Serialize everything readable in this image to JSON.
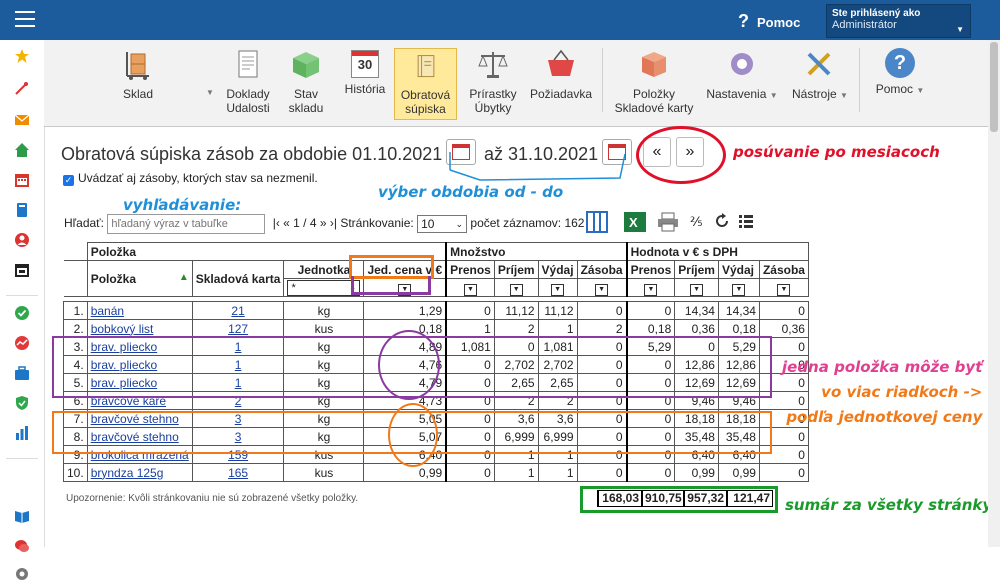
{
  "header": {
    "help_label": "Pomoc",
    "user_line1": "Ste prihlásený ako",
    "user_line2": "Administrátor"
  },
  "toolbar": {
    "sklad": "Sklad",
    "doklady1": "Doklady",
    "doklady2": "Udalosti",
    "stav1": "Stav",
    "stav2": "skladu",
    "historia": "História",
    "historia_day": "30",
    "obratova1": "Obratová",
    "obratova2": "súpiska",
    "prirastky1": "Prírastky",
    "prirastky2": "Úbytky",
    "poziadavka": "Požiadavka",
    "polozky1": "Položky",
    "polozky2": "Skladové karty",
    "nastavenia": "Nastavenia",
    "nastroje": "Nástroje",
    "pomoc": "Pomoc"
  },
  "page": {
    "title": "Obratová súpiska zásob za obdobie 01.10.2021",
    "to": "až 31.10.2021",
    "checkbox": "Uvádzať aj zásoby, ktorých stav sa nezmenil.",
    "prev": "«",
    "next": "»"
  },
  "search": {
    "label": "Hľadať:",
    "placeholder": "hľadaný výraz v tabuľke",
    "pager": "|‹ « 1 / 4 » ›|",
    "paging_label": "Stránkovanie:",
    "paging_value": "10",
    "count": "počet záznamov: 162",
    "per_mille": "⅖"
  },
  "table": {
    "group_item": "Položka",
    "group_qty": "Množstvo",
    "group_val": "Hodnota v € s DPH",
    "h_item": "Položka",
    "h_card": "Skladová karta",
    "h_unit": "Jednotka",
    "h_price": "Jed. cena v €",
    "h_q1": "Prenos",
    "h_q2": "Príjem",
    "h_q3": "Výdaj",
    "h_q4": "Zásoba",
    "h_v1": "Prenos",
    "h_v2": "Príjem",
    "h_v3": "Výdaj",
    "h_v4": "Zásoba",
    "unit_filter": "*",
    "rows": [
      {
        "n": "1.",
        "item": "banán",
        "card": "21",
        "unit": "kg",
        "price": "1,29",
        "q1": "0",
        "q2": "11,12",
        "q3": "11,12",
        "q4": "0",
        "v1": "0",
        "v2": "14,34",
        "v3": "14,34",
        "v4": "0"
      },
      {
        "n": "2.",
        "item": "bobkový list",
        "card": "127",
        "unit": "kus",
        "price": "0,18",
        "q1": "1",
        "q2": "2",
        "q3": "1",
        "q4": "2",
        "v1": "0,18",
        "v2": "0,36",
        "v3": "0,18",
        "v4": "0,36"
      },
      {
        "n": "3.",
        "item": "brav. pliecko",
        "card": "1",
        "unit": "kg",
        "price": "4,89",
        "q1": "1,081",
        "q2": "0",
        "q3": "1,081",
        "q4": "0",
        "v1": "5,29",
        "v2": "0",
        "v3": "5,29",
        "v4": "0"
      },
      {
        "n": "4.",
        "item": "brav. pliecko",
        "card": "1",
        "unit": "kg",
        "price": "4,76",
        "q1": "0",
        "q2": "2,702",
        "q3": "2,702",
        "q4": "0",
        "v1": "0",
        "v2": "12,86",
        "v3": "12,86",
        "v4": "0"
      },
      {
        "n": "5.",
        "item": "brav. pliecko",
        "card": "1",
        "unit": "kg",
        "price": "4,79",
        "q1": "0",
        "q2": "2,65",
        "q3": "2,65",
        "q4": "0",
        "v1": "0",
        "v2": "12,69",
        "v3": "12,69",
        "v4": "0"
      },
      {
        "n": "6.",
        "item": "bravčové karé",
        "card": "2",
        "unit": "kg",
        "price": "4,73",
        "q1": "0",
        "q2": "2",
        "q3": "2",
        "q4": "0",
        "v1": "0",
        "v2": "9,46",
        "v3": "9,46",
        "v4": "0"
      },
      {
        "n": "7.",
        "item": "bravčové stehno",
        "card": "3",
        "unit": "kg",
        "price": "5,05",
        "q1": "0",
        "q2": "3,6",
        "q3": "3,6",
        "q4": "0",
        "v1": "0",
        "v2": "18,18",
        "v3": "18,18",
        "v4": "0"
      },
      {
        "n": "8.",
        "item": "bravčové stehno",
        "card": "3",
        "unit": "kg",
        "price": "5,07",
        "q1": "0",
        "q2": "6,999",
        "q3": "6,999",
        "q4": "0",
        "v1": "0",
        "v2": "35,48",
        "v3": "35,48",
        "v4": "0"
      },
      {
        "n": "9.",
        "item": "brokolica mrazená",
        "card": "159",
        "unit": "kus",
        "price": "6,40",
        "q1": "0",
        "q2": "1",
        "q3": "1",
        "q4": "0",
        "v1": "0",
        "v2": "6,40",
        "v3": "6,40",
        "v4": "0"
      },
      {
        "n": "10.",
        "item": "bryndza 125g",
        "card": "165",
        "unit": "kus",
        "price": "0,99",
        "q1": "0",
        "q2": "1",
        "q3": "1",
        "q4": "0",
        "v1": "0",
        "v2": "0,99",
        "v3": "0,99",
        "v4": "0"
      }
    ],
    "note": "Upozornenie: Kvôli stránkovaniu nie sú zobrazené všetky položky.",
    "sum": {
      "v1": "168,03",
      "v2": "910,75",
      "v3": "957,32",
      "v4": "121,47"
    }
  },
  "annotations": {
    "months": "posúvanie po mesiacoch",
    "period": "výber obdobia  od - do",
    "search": "vyhľadávanie:",
    "rows1": "jedna položka môže byť",
    "rows2": "vo viac riadkoch ->",
    "rows3": "podľa jednotkovej ceny",
    "sum": "sumár za všetky stránky"
  },
  "colors": {
    "topbar": "#1c5c9c",
    "annotation_red": "#e0102a",
    "annotation_blue": "#1f8fd8",
    "annotation_purple": "#8a3aa0",
    "annotation_orange": "#f07a1a",
    "annotation_green": "#1a9a2a"
  }
}
